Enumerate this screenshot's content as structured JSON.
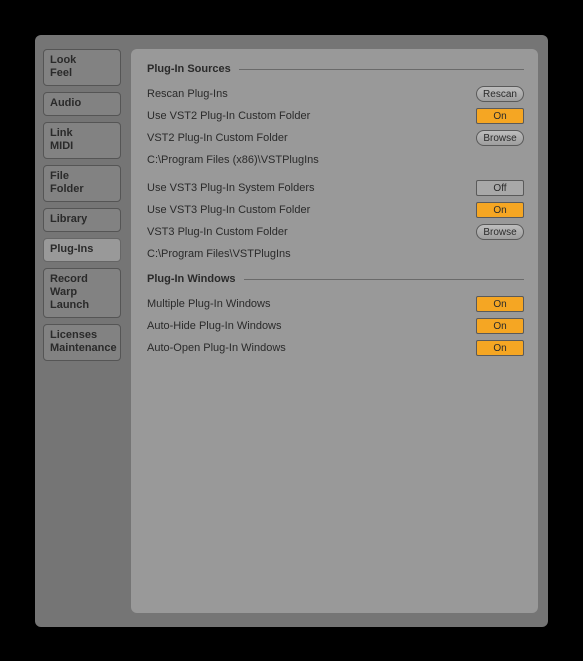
{
  "sidebar": {
    "items": [
      {
        "label": "Look\nFeel"
      },
      {
        "label": "Audio"
      },
      {
        "label": "Link\nMIDI"
      },
      {
        "label": "File\nFolder"
      },
      {
        "label": "Library"
      },
      {
        "label": "Plug-Ins"
      },
      {
        "label": "Record\nWarp\nLaunch"
      },
      {
        "label": "Licenses\nMaintenance"
      }
    ],
    "active_index": 5
  },
  "sections": {
    "sources": {
      "title": "Plug-In Sources",
      "rescan_label": "Rescan Plug-Ins",
      "rescan_btn": "Rescan",
      "use_vst2_custom_label": "Use VST2 Plug-In Custom Folder",
      "use_vst2_custom_state": "On",
      "vst2_folder_label": "VST2 Plug-In Custom Folder",
      "vst2_browse_btn": "Browse",
      "vst2_path": "C:\\Program Files (x86)\\VSTPlugIns",
      "use_vst3_system_label": "Use VST3 Plug-In System Folders",
      "use_vst3_system_state": "Off",
      "use_vst3_custom_label": "Use VST3 Plug-In Custom Folder",
      "use_vst3_custom_state": "On",
      "vst3_folder_label": "VST3 Plug-In Custom Folder",
      "vst3_browse_btn": "Browse",
      "vst3_path": "C:\\Program Files\\VSTPlugIns"
    },
    "windows": {
      "title": "Plug-In Windows",
      "multiple_label": "Multiple Plug-In Windows",
      "multiple_state": "On",
      "autohide_label": "Auto-Hide Plug-In Windows",
      "autohide_state": "On",
      "autoopen_label": "Auto-Open Plug-In Windows",
      "autoopen_state": "On"
    }
  }
}
